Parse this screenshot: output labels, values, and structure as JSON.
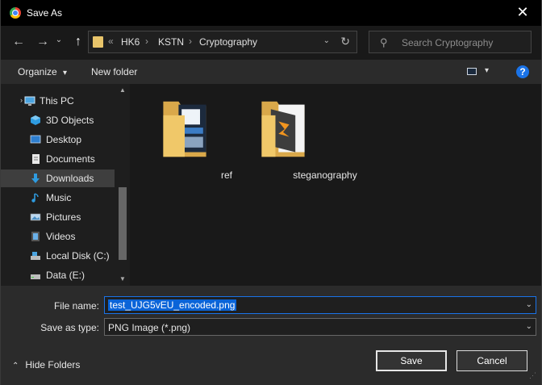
{
  "window": {
    "title": "Save As",
    "close_glyph": "✕"
  },
  "nav": {
    "back_glyph": "←",
    "forward_glyph": "→",
    "recent_glyph": "⌄",
    "up_glyph": "↑",
    "overflow": "«",
    "breadcrumbs": [
      "HK6",
      "KSTN",
      "Cryptography"
    ],
    "separator": "›",
    "dropdown_glyph": "⌄",
    "refresh_glyph": "↻"
  },
  "search": {
    "icon_glyph": "⚲",
    "placeholder": "Search Cryptography"
  },
  "toolbar": {
    "organize": "Organize",
    "organize_chev": "▾",
    "new_folder": "New folder",
    "view_chev": "▾",
    "help": "?"
  },
  "sidebar": {
    "items": [
      {
        "label": "This PC",
        "icon": "pc-icon",
        "expander": "›"
      },
      {
        "label": "3D Objects",
        "icon": "3d-objects-icon"
      },
      {
        "label": "Desktop",
        "icon": "desktop-icon"
      },
      {
        "label": "Documents",
        "icon": "documents-icon"
      },
      {
        "label": "Downloads",
        "icon": "downloads-icon",
        "selected": true
      },
      {
        "label": "Music",
        "icon": "music-icon"
      },
      {
        "label": "Pictures",
        "icon": "pictures-icon"
      },
      {
        "label": "Videos",
        "icon": "videos-icon"
      },
      {
        "label": "Local Disk (C:)",
        "icon": "local-disk-icon"
      },
      {
        "label": "Data (E:)",
        "icon": "drive-icon"
      }
    ],
    "scroll_up": "▲",
    "scroll_down": "▼"
  },
  "content": {
    "items": [
      {
        "name": "ref",
        "type": "folder"
      },
      {
        "name": "steganography",
        "type": "folder"
      }
    ]
  },
  "form": {
    "file_name_label": "File name:",
    "file_name_value": "test_UJG5vEU_encoded.png",
    "type_label": "Save as type:",
    "type_value": "PNG Image (*.png)",
    "dropdown_glyph": "⌄"
  },
  "footer": {
    "hide_folders": "Hide Folders",
    "hide_chev": "⌃",
    "save": "Save",
    "cancel": "Cancel"
  },
  "colors": {
    "accent": "#1a73e8",
    "folder": "#e8c46a",
    "selection": "#0a64d8"
  }
}
